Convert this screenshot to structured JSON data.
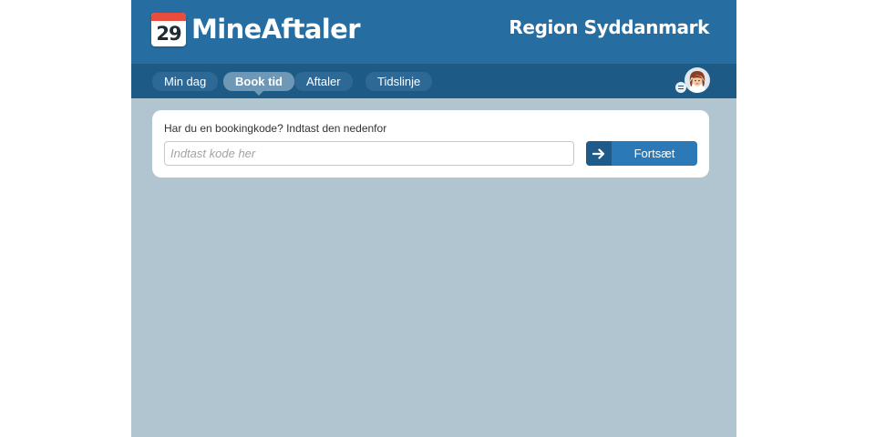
{
  "header": {
    "calendar_day": "29",
    "app_name": "MineAftaler",
    "region": "Region Syddanmark"
  },
  "nav": {
    "tabs": [
      {
        "label": "Min dag",
        "active": false
      },
      {
        "label": "Book tid",
        "active": true
      },
      {
        "label": "Aftaler",
        "active": false
      },
      {
        "label": "Tidslinje",
        "active": false
      }
    ]
  },
  "booking": {
    "prompt": "Har du en bookingkode? Indtast den nedenfor",
    "input_value": "",
    "input_placeholder": "Indtast kode her",
    "continue_label": "Fortsæt",
    "continue_icon": "arrow-right-icon"
  },
  "colors": {
    "header_bg": "#266ea2",
    "nav_bg": "#1e5a86",
    "page_bg": "#b1c5d0",
    "accent": "#2b7ab7",
    "calendar_red": "#e74c3c"
  }
}
